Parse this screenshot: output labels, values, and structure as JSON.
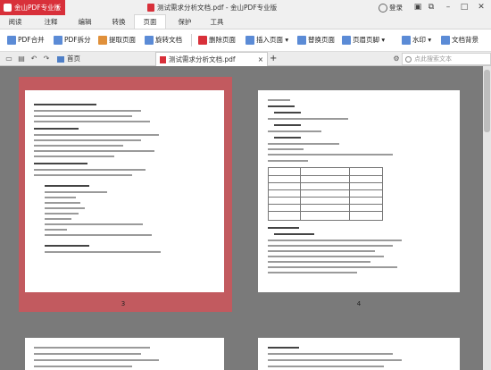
{
  "app": {
    "brand": "金山PDF专业版",
    "title": "测试需求分析文档.pdf - 金山PDF专业版",
    "login": "登录",
    "colors": {
      "brand": "#d8303a",
      "selection": "#c25a5f",
      "workspace": "#7a7a7a"
    }
  },
  "window_controls": {
    "skin_icon": "shirt-icon",
    "minimize": "–",
    "maximize": "□",
    "close": "✕"
  },
  "menu": [
    "阅读",
    "注释",
    "编辑",
    "转换",
    "页面",
    "保护",
    "工具"
  ],
  "menu_active": "页面",
  "toolbar": {
    "pdf_merge": "PDF合并",
    "pdf_split": "PDF拆分",
    "extract_page": "提取页面",
    "rotate_doc": "旋转文档",
    "delete_page": "删除页面",
    "insert_page": "插入页面",
    "replace_page": "替换页面",
    "header_footer": "页眉页脚",
    "watermark": "水印",
    "doc_background": "文档背景"
  },
  "tabs": {
    "home": "首页",
    "doc": "测试需求分析文档.pdf",
    "add": "+",
    "close": "×",
    "search_placeholder": "点此搜索文本"
  },
  "pages": {
    "left_number": "3",
    "right_number": "4"
  }
}
